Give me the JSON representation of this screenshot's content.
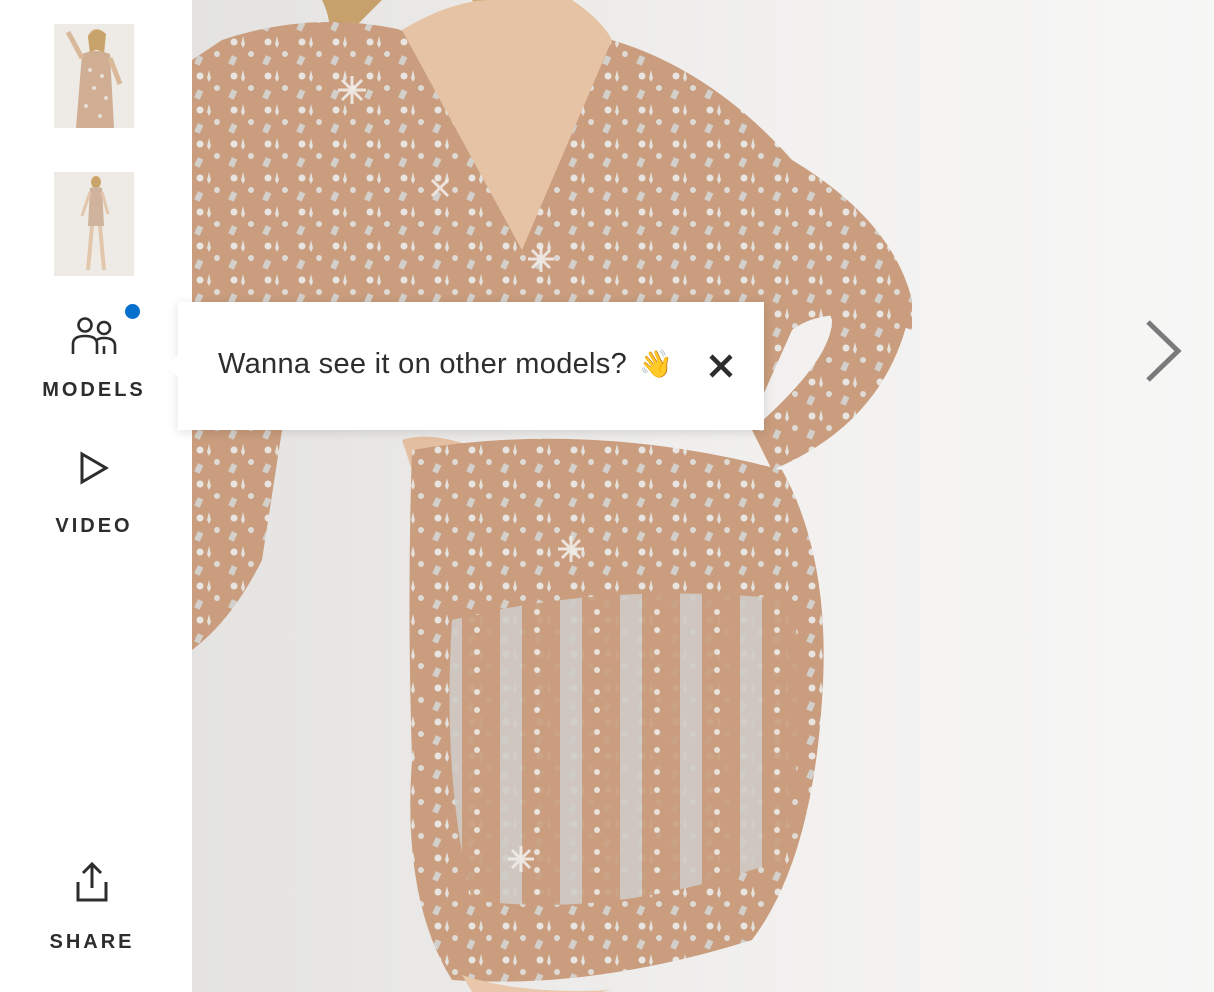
{
  "thumbnails": [
    {
      "alt": "thumbnail-1"
    },
    {
      "alt": "thumbnail-2"
    }
  ],
  "sidebar": {
    "models_label": "MODELS",
    "video_label": "VIDEO",
    "share_label": "SHARE"
  },
  "tooltip": {
    "text": "Wanna see it on other models?",
    "emoji": "👋"
  },
  "icons": {
    "models": "people-icon",
    "video": "play-icon",
    "share": "share-icon",
    "close": "close-icon",
    "next": "chevron-right-icon"
  },
  "colors": {
    "notification_dot": "#0770cf",
    "text": "#2d2d2d",
    "dress_base": "#c79b7b",
    "sequin": "#d9d6d1"
  }
}
